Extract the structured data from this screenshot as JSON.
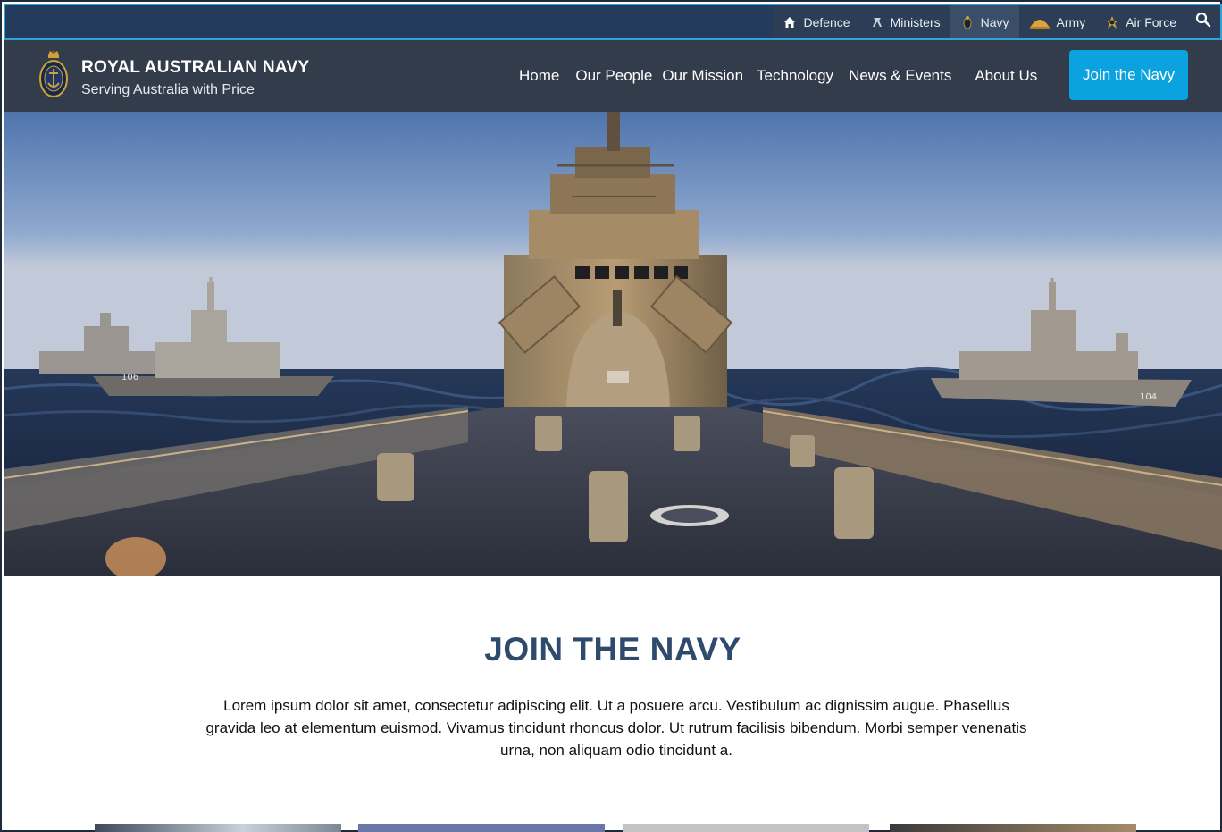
{
  "topbar": {
    "items": [
      {
        "label": "Defence",
        "icon": "home-icon"
      },
      {
        "label": "Ministers",
        "icon": "ministers-icon"
      },
      {
        "label": "Navy",
        "icon": "navy-badge-icon",
        "active": true
      },
      {
        "label": "Army",
        "icon": "army-badge-icon"
      },
      {
        "label": "Air Force",
        "icon": "air-force-badge-icon"
      }
    ],
    "search_icon": "search-icon"
  },
  "header": {
    "title": "ROYAL AUSTRALIAN NAVY",
    "subtitle": "Serving Australia with Price",
    "logo": "navy-crest-logo",
    "nav": [
      "Home",
      "Our People",
      "Our Mission",
      "Technology",
      "News & Events",
      "About Us"
    ],
    "cta": "Join the Navy"
  },
  "hero": {
    "image": "warship-bow-fleet-photo",
    "hull_numbers": [
      "106",
      "104"
    ]
  },
  "join_section": {
    "heading": "JOIN THE NAVY",
    "body": "Lorem ipsum dolor sit amet, consectetur adipiscing elit. Ut a posuere arcu. Vestibulum ac dignissim augue. Phasellus gravida leo at elementum euismod. Vivamus tincidunt rhoncus dolor. Ut rutrum facilisis bibendum. Morbi semper venenatis urna, non aliquam odio tincidunt a."
  },
  "colors": {
    "topbar_bg": "#243b5e",
    "header_bg": "#333c4b",
    "accent": "#0aa3e0",
    "heading": "#2e4a6c"
  }
}
